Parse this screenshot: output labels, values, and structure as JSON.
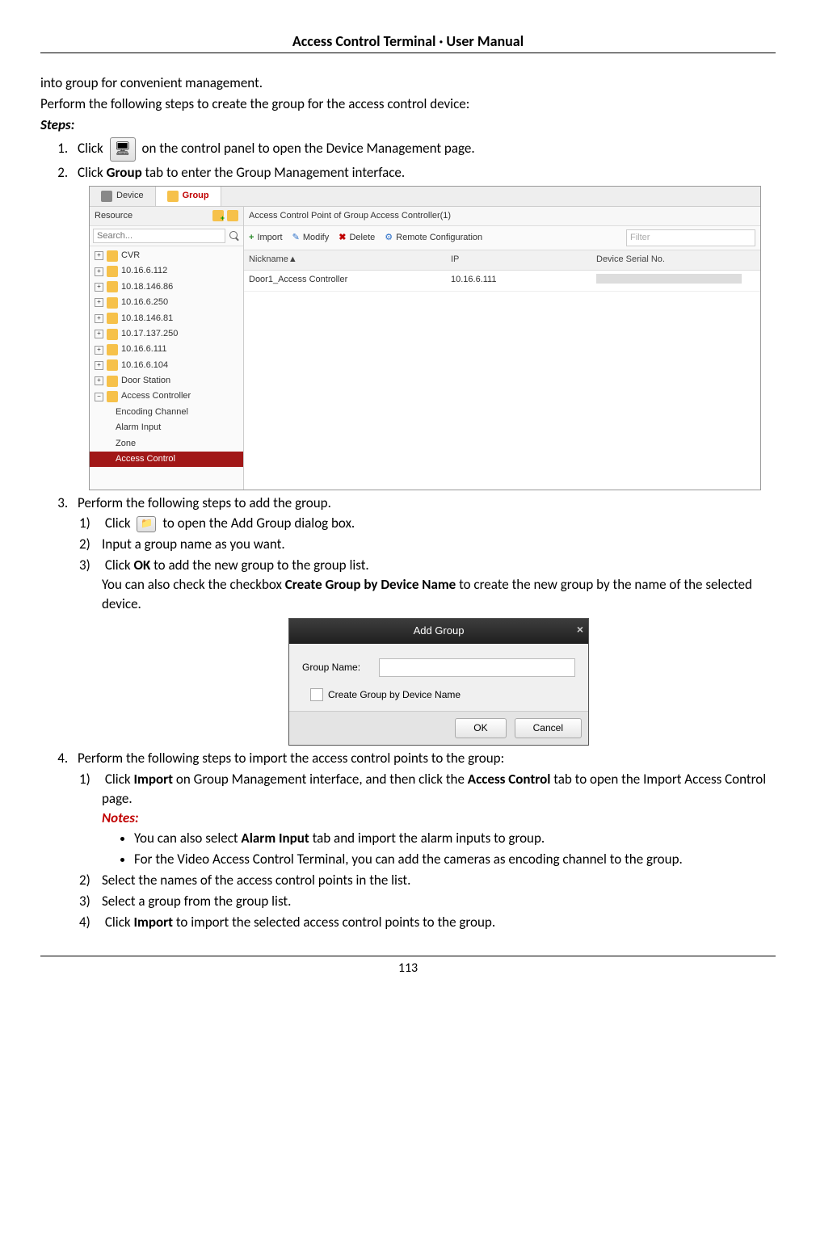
{
  "header": {
    "title": "Access Control Terminal · User Manual"
  },
  "page_number": "113",
  "intro": {
    "line1": "into group for convenient management.",
    "line2": "Perform the following steps to create the group for the access control device:",
    "steps_label": "Steps:"
  },
  "step1": {
    "pre": "Click ",
    "post": " on the control panel to open the Device Management page."
  },
  "step2": {
    "pre": "Click ",
    "bold": "Group",
    "post": " tab to enter the Group Management interface."
  },
  "gm": {
    "tabs": {
      "device": "Device",
      "group": "Group"
    },
    "resource_label": "Resource",
    "search_placeholder": "Search...",
    "tree": [
      {
        "type": "exp",
        "label": "CVR"
      },
      {
        "type": "exp",
        "label": "10.16.6.112"
      },
      {
        "type": "exp",
        "label": "10.18.146.86"
      },
      {
        "type": "exp",
        "label": "10.16.6.250"
      },
      {
        "type": "exp",
        "label": "10.18.146.81"
      },
      {
        "type": "exp",
        "label": "10.17.137.250"
      },
      {
        "type": "exp",
        "label": "10.16.6.111"
      },
      {
        "type": "exp",
        "label": "10.16.6.104"
      },
      {
        "type": "exp",
        "label": "Door Station"
      },
      {
        "type": "col",
        "label": "Access Controller"
      },
      {
        "type": "child",
        "label": "Encoding Channel"
      },
      {
        "type": "child",
        "label": "Alarm Input"
      },
      {
        "type": "child",
        "label": "Zone"
      },
      {
        "type": "selected",
        "label": "Access Control"
      }
    ],
    "main_title": "Access Control Point of Group Access Controller(1)",
    "toolbar": {
      "import": "Import",
      "modify": "Modify",
      "delete": "Delete",
      "remote": "Remote Configuration",
      "filter_placeholder": "Filter"
    },
    "columns": {
      "nickname": "Nickname",
      "ip": "IP",
      "serial": "Device Serial No."
    },
    "rows": [
      {
        "nickname": "Door1_Access Controller",
        "ip": "10.16.6.111",
        "serial": ""
      }
    ]
  },
  "step3": {
    "text": "Perform the following steps to add the group.",
    "s1_pre": "Click ",
    "s1_post": " to open the Add Group dialog box.",
    "s2": "Input a group name as you want.",
    "s3_pre": "Click ",
    "s3_b1": "OK",
    "s3_mid": " to add the new group to the group list.",
    "s3_line2_pre": "You can also check the checkbox ",
    "s3_b2": "Create Group by Device Name",
    "s3_line2_post": " to create the new group by the name of the selected device."
  },
  "dlg": {
    "title": "Add Group",
    "group_name_label": "Group Name:",
    "checkbox_label": "Create Group by Device Name",
    "ok": "OK",
    "cancel": "Cancel"
  },
  "step4": {
    "text": "Perform the following steps to import the access control points to the group:",
    "s1_pre": "Click ",
    "s1_b1": "Import",
    "s1_mid": " on Group Management interface, and then click the ",
    "s1_b2": "Access Control",
    "s1_post": " tab to open the Import Access Control page.",
    "notes_label": "Notes:",
    "n1_pre": "You can also select ",
    "n1_b": "Alarm Input",
    "n1_post": " tab and import the alarm inputs to group.",
    "n2": "For the Video Access Control Terminal, you can add the cameras as encoding channel to the group.",
    "s2": "Select the names of the access control points in the list.",
    "s3": "Select a group from the group list.",
    "s4_pre": "Click ",
    "s4_b": "Import",
    "s4_post": " to import the selected access control points to the group."
  }
}
